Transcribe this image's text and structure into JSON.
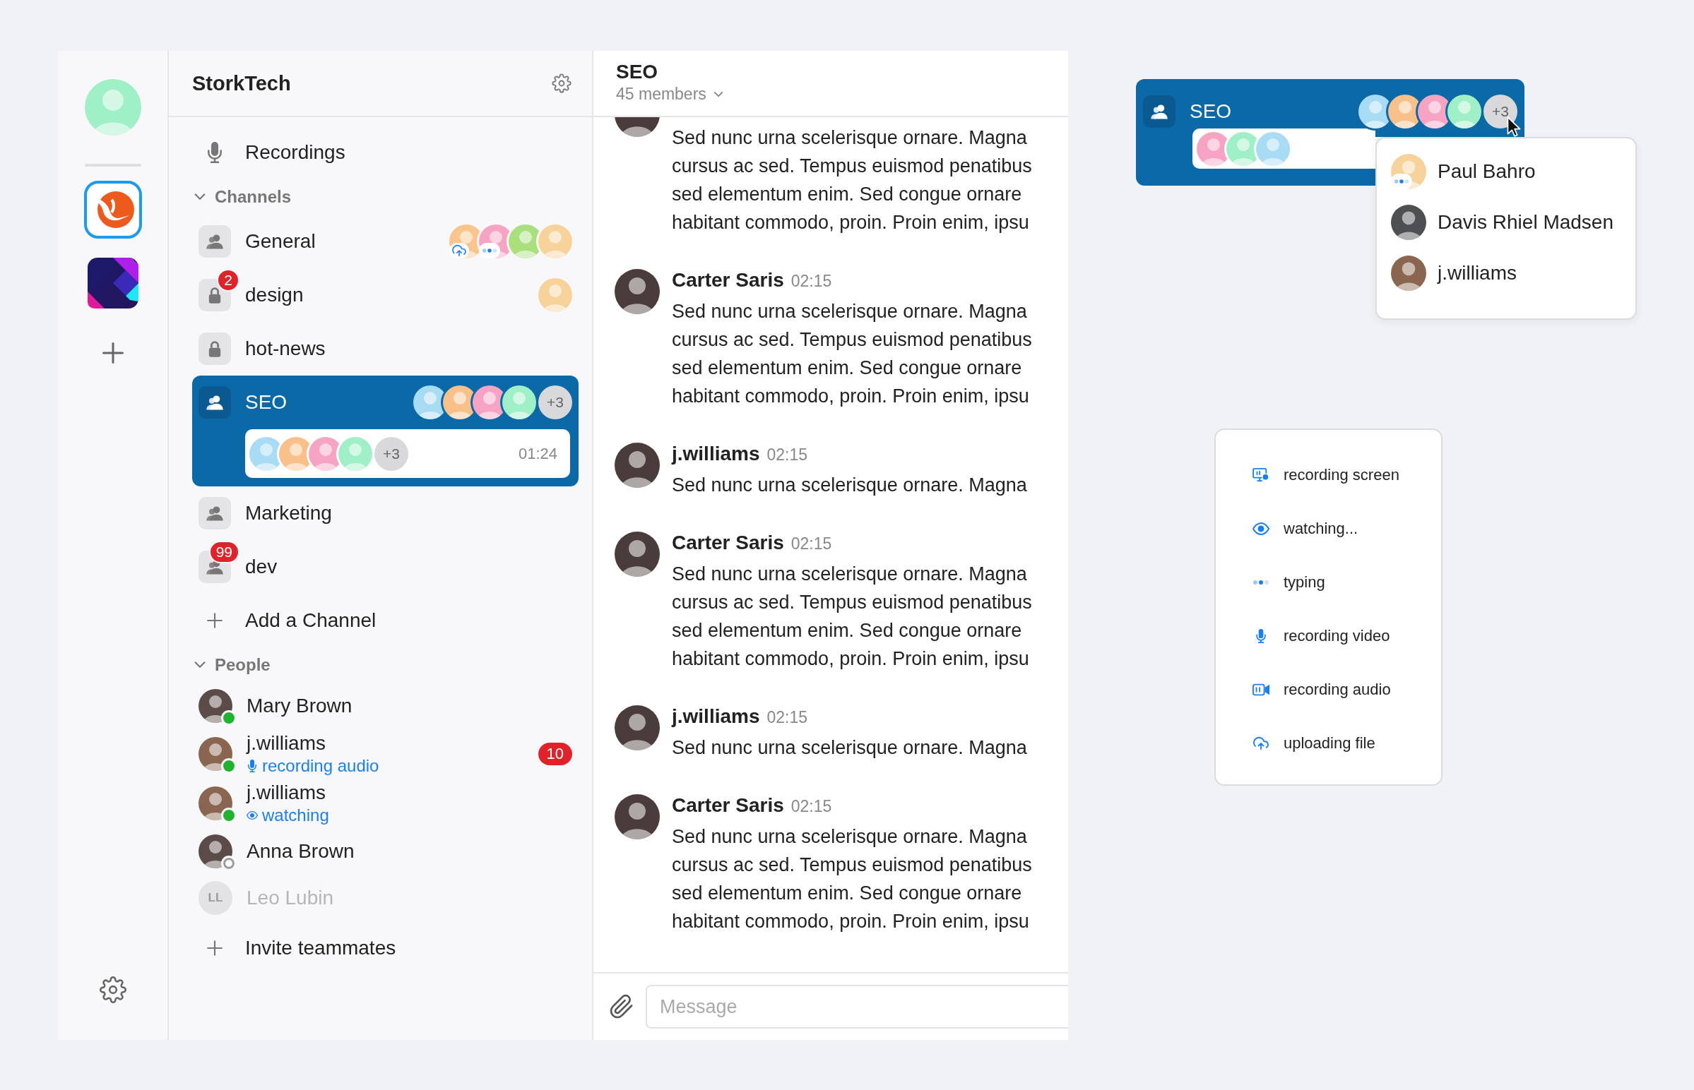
{
  "rail": {
    "user_avatar": {
      "color": "#9ff0c6"
    },
    "workspaces": [
      {
        "kind": "stork",
        "selected": true
      },
      {
        "kind": "prism",
        "selected": false
      }
    ]
  },
  "sidebar": {
    "title": "StorkTech",
    "recordings": "Recordings",
    "channels": {
      "heading": "Channels",
      "expanded": true,
      "items": [
        {
          "name": "General",
          "kind": "group",
          "selected": false,
          "avatars": [
            {
              "color": "#f9c58d",
              "kind": "upload"
            },
            {
              "color": "#f6a3c4",
              "kind": "typing"
            },
            {
              "color": "#a9e07c"
            },
            {
              "color": "#f7d29b"
            }
          ]
        },
        {
          "name": "design",
          "kind": "lock",
          "selected": false,
          "badge": "2",
          "avatars": [
            {
              "color": "#f7d29b"
            }
          ]
        },
        {
          "name": "hot-news",
          "kind": "lock",
          "selected": false
        },
        {
          "name": "SEO",
          "kind": "group",
          "selected": true,
          "avatars": [
            {
              "color": "#a8dcf5"
            },
            {
              "color": "#f9c08a"
            },
            {
              "color": "#f6a3c4"
            },
            {
              "color": "#9ff0c6"
            }
          ],
          "more": "+3",
          "call": {
            "avatars": [
              {
                "color": "#a8dcf5"
              },
              {
                "color": "#f9c08a"
              },
              {
                "color": "#f6a3c4"
              },
              {
                "color": "#9ff0c6"
              }
            ],
            "more": "+3",
            "duration": "01:24"
          }
        },
        {
          "name": "Marketing",
          "kind": "group",
          "selected": false
        },
        {
          "name": "dev",
          "kind": "group",
          "selected": false,
          "badge": "99"
        }
      ]
    },
    "add_channel": "Add a Channel",
    "people": {
      "heading": "People",
      "expanded": true,
      "items": [
        {
          "name": "Mary Brown",
          "avatar": {
            "color": "#5b4c4a"
          },
          "online": true,
          "disabled": false
        },
        {
          "name": "j.williams",
          "avatar": {
            "color": "#8a6650"
          },
          "online": true,
          "disabled": false,
          "activity": {
            "kind": "mic",
            "text": "recording audio"
          },
          "unread": "10"
        },
        {
          "name": "j.williams",
          "avatar": {
            "color": "#8a6650"
          },
          "online": true,
          "disabled": false,
          "activity": {
            "kind": "eye",
            "text": "watching"
          }
        },
        {
          "name": "Anna Brown",
          "avatar": {
            "color": "#5b4c4a"
          },
          "online": false,
          "disabled": false
        },
        {
          "name": "Leo Lubin",
          "avatar": {
            "initials": "LL"
          },
          "disabled": true
        }
      ]
    },
    "invite": "Invite teammates"
  },
  "chat": {
    "title": "SEO",
    "members": "45 members",
    "messages": [
      {
        "avatar": {
          "color": "#4a3c3a"
        },
        "lines": [
          "Sed nunc urna scelerisque ornare. Magna",
          "cursus ac sed. Tempus euismod penatibus",
          "sed elementum enim. Sed congue ornare",
          "habitant commodo, proin. Proin enim, ipsu"
        ]
      },
      {
        "author": "Carter Saris",
        "time": "02:15",
        "avatar": {
          "color": "#4a3c3a"
        },
        "lines": [
          "Sed nunc urna scelerisque ornare. Magna",
          "cursus ac sed. Tempus euismod penatibus",
          "sed elementum enim. Sed congue ornare",
          "habitant commodo, proin. Proin enim, ipsu"
        ]
      },
      {
        "author": "j.williams",
        "time": "02:15",
        "avatar": {
          "color": "#4a3c3a"
        },
        "lines": [
          "Sed nunc urna scelerisque ornare. Magna"
        ]
      },
      {
        "author": "Carter Saris",
        "time": "02:15",
        "avatar": {
          "color": "#4a3c3a"
        },
        "lines": [
          "Sed nunc urna scelerisque ornare. Magna",
          "cursus ac sed. Tempus euismod penatibus",
          "sed elementum enim. Sed congue ornare",
          "habitant commodo, proin. Proin enim, ipsu"
        ]
      },
      {
        "author": "j.williams",
        "time": "02:15",
        "avatar": {
          "color": "#4a3c3a"
        },
        "lines": [
          "Sed nunc urna scelerisque ornare. Magna"
        ]
      },
      {
        "author": "Carter Saris",
        "time": "02:15",
        "avatar": {
          "color": "#4a3c3a"
        },
        "lines": [
          "Sed nunc urna scelerisque ornare. Magna",
          "cursus ac sed. Tempus euismod penatibus",
          "sed elementum enim. Sed congue ornare",
          "habitant commodo, proin. Proin enim, ipsu"
        ]
      }
    ],
    "composer": {
      "placeholder": "Message"
    }
  },
  "seo_card": {
    "name": "SEO",
    "avatars": [
      {
        "color": "#a8dcf5"
      },
      {
        "color": "#f9c08a"
      },
      {
        "color": "#f6a3c4"
      },
      {
        "color": "#9ff0c6"
      }
    ],
    "more": "+3",
    "call_avatars": [
      {
        "color": "#f6a3c4"
      },
      {
        "color": "#9ff0c6"
      },
      {
        "color": "#a8dcf5"
      }
    ]
  },
  "members_popup": {
    "items": [
      {
        "name": "Paul Bahro",
        "avatar": {
          "color": "#f7d29b",
          "kind": "typing"
        }
      },
      {
        "name": "Davis Rhiel Madsen",
        "avatar": {
          "color": "#4d4f52"
        }
      },
      {
        "name": "j.williams",
        "avatar": {
          "color": "#8a6650"
        }
      }
    ]
  },
  "legend": {
    "items": [
      {
        "kind": "screen",
        "text": "recording screen"
      },
      {
        "kind": "eye",
        "text": "watching..."
      },
      {
        "kind": "dots",
        "text": "typing"
      },
      {
        "kind": "mic",
        "text": "recording video"
      },
      {
        "kind": "camera",
        "text": "recording audio"
      },
      {
        "kind": "cloud",
        "text": "uploading file"
      }
    ]
  }
}
